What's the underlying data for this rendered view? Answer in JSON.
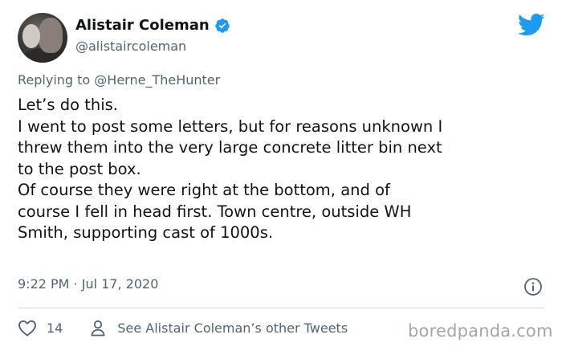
{
  "author": {
    "display_name": "Alistair Coleman",
    "handle": "@alistaircoleman",
    "verified": true
  },
  "reply": {
    "prefix": "Replying to ",
    "mention": "@Herne_TheHunter"
  },
  "tweet": {
    "lines": [
      "Let’s do this.",
      "I went to post some letters, but for reasons unknown I",
      "threw them into the very large concrete litter bin next",
      "to the post box.",
      "Of course they were right at the bottom, and of",
      "course I fell in head first. Town centre, outside WH",
      "Smith, supporting cast of 1000s."
    ]
  },
  "meta": {
    "timestamp": "9:22 PM · Jul 17, 2020"
  },
  "actions": {
    "likes": "14",
    "other_tweets": "See Alistair Coleman’s other Tweets"
  },
  "watermark": "boredpanda.com",
  "colors": {
    "twitter_blue": "#1d9bf0",
    "text": "#0f1419",
    "secondary": "#536471",
    "watermark": "#a2a7ab"
  },
  "icons": [
    "verified-badge-icon",
    "twitter-bird-icon",
    "info-icon",
    "heart-icon",
    "person-icon"
  ]
}
